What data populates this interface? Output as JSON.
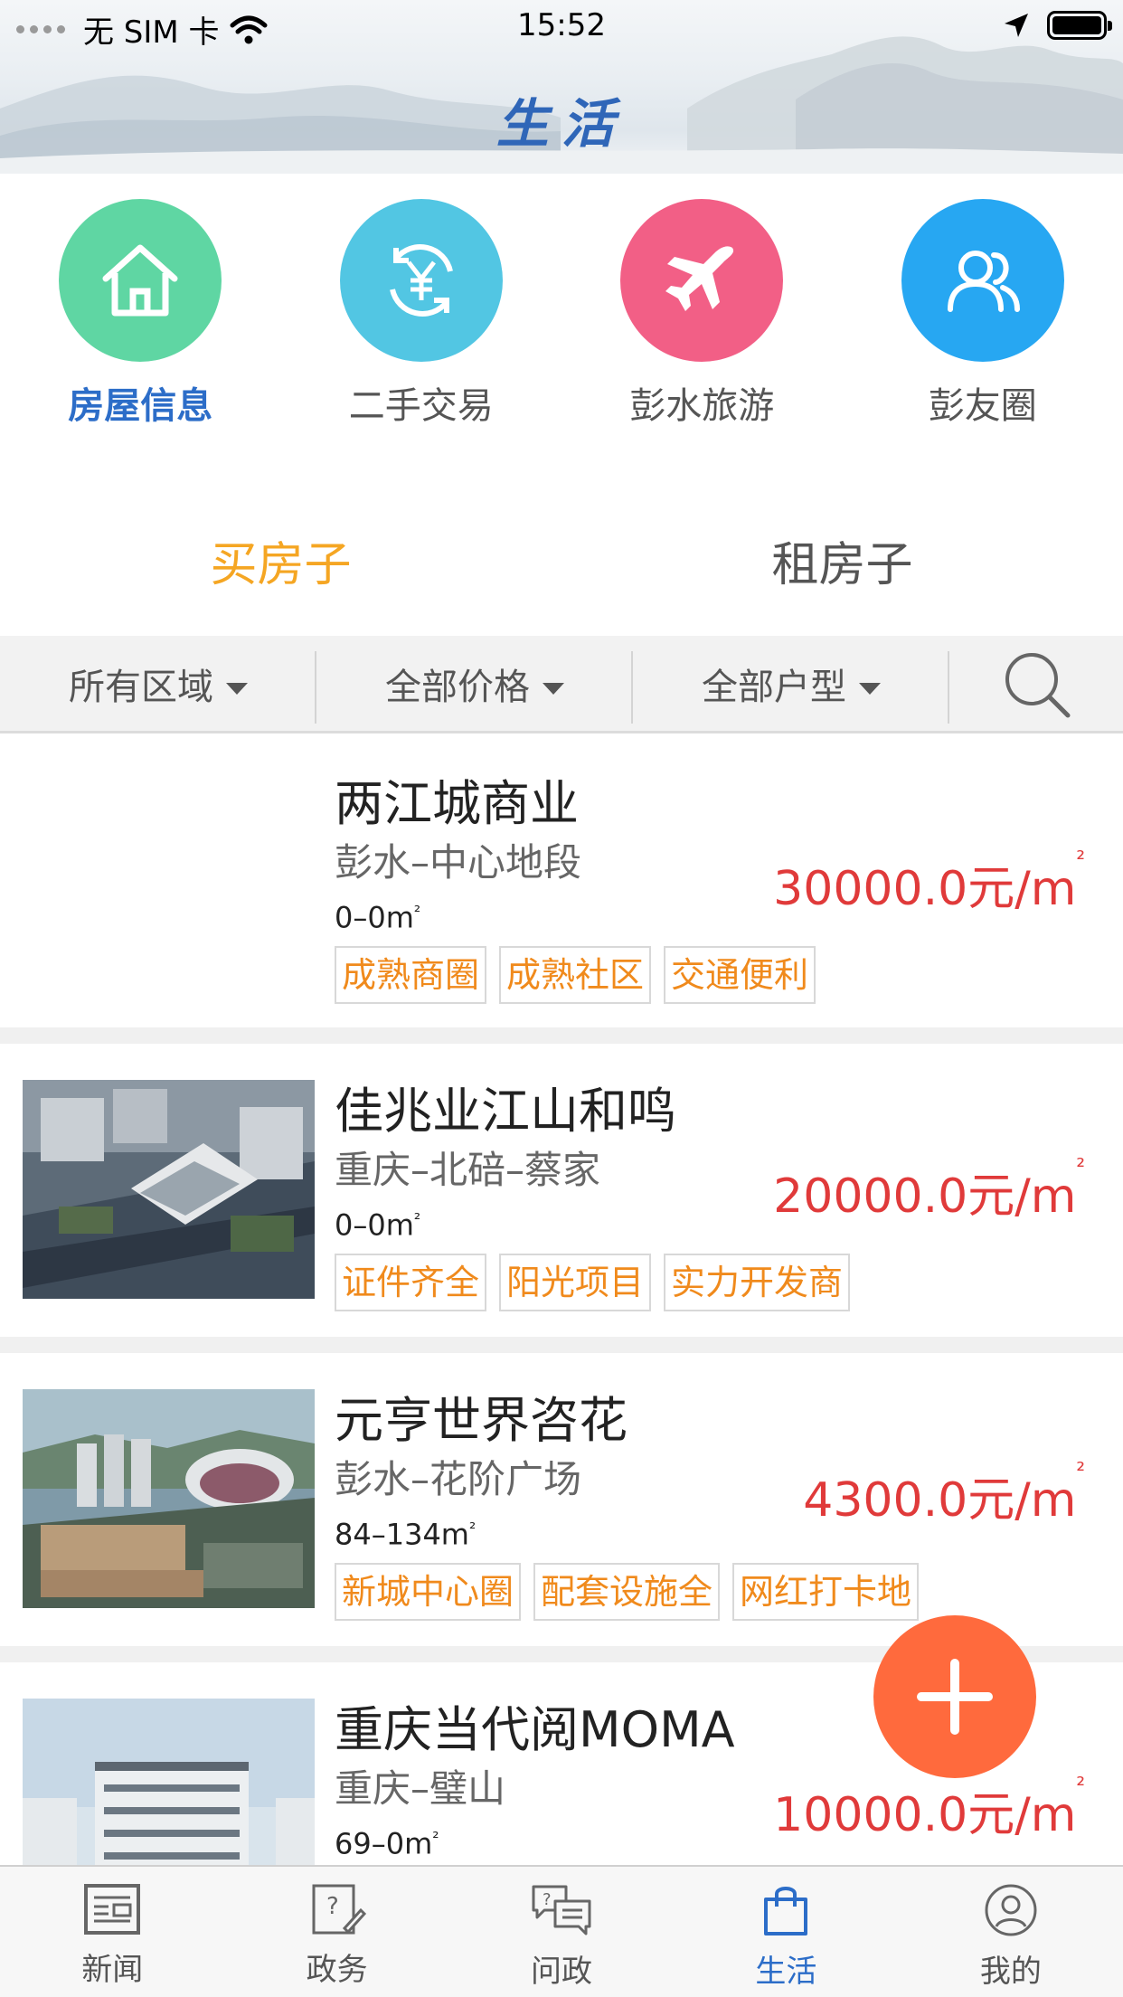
{
  "status": {
    "carrier": "无 SIM 卡",
    "time": "15:52"
  },
  "header": {
    "title": "生活"
  },
  "categories": [
    {
      "label": "房屋信息",
      "icon": "house-icon",
      "color": "#5fd6a3",
      "active": true
    },
    {
      "label": "二手交易",
      "icon": "yuan-exchange-icon",
      "color": "#52c6e3",
      "active": false
    },
    {
      "label": "彭水旅游",
      "icon": "airplane-icon",
      "color": "#f25f86",
      "active": false
    },
    {
      "label": "彭友圈",
      "icon": "people-icon",
      "color": "#27a7f2",
      "active": false
    }
  ],
  "tabs": [
    {
      "label": "买房子",
      "active": true
    },
    {
      "label": "租房子",
      "active": false
    }
  ],
  "filters": {
    "region": "所有区域",
    "price": "全部价格",
    "layout": "全部户型"
  },
  "listings": [
    {
      "name": "两江城商业",
      "location": "彭水–中心地段",
      "area": "0–0m",
      "price": "30000.0元/m",
      "tags": [
        "成熟商圈",
        "成熟社区",
        "交通便利"
      ],
      "has_image": false
    },
    {
      "name": "佳兆业江山和鸣",
      "location": "重庆–北碚–蔡家",
      "area": "0–0m",
      "price": "20000.0元/m",
      "tags": [
        "证件齐全",
        "阳光项目",
        "实力开发商"
      ],
      "has_image": true
    },
    {
      "name": "元亨世界咨花",
      "location": "彭水–花阶广场",
      "area": "84–134m",
      "price": "4300.0元/m",
      "tags": [
        "新城中心圈",
        "配套设施全",
        "网红打卡地"
      ],
      "has_image": true
    },
    {
      "name": "重庆当代阅MOMA",
      "location": "重庆–璧山",
      "area": "69–0m",
      "price": "10000.0元/m",
      "tags": [],
      "has_image": true
    }
  ],
  "sq": "²",
  "nav": [
    {
      "label": "新闻",
      "icon": "news-icon"
    },
    {
      "label": "政务",
      "icon": "government-icon"
    },
    {
      "label": "问政",
      "icon": "inquiry-icon"
    },
    {
      "label": "生活",
      "icon": "shopping-bag-icon",
      "active": true
    },
    {
      "label": "我的",
      "icon": "profile-icon"
    }
  ]
}
